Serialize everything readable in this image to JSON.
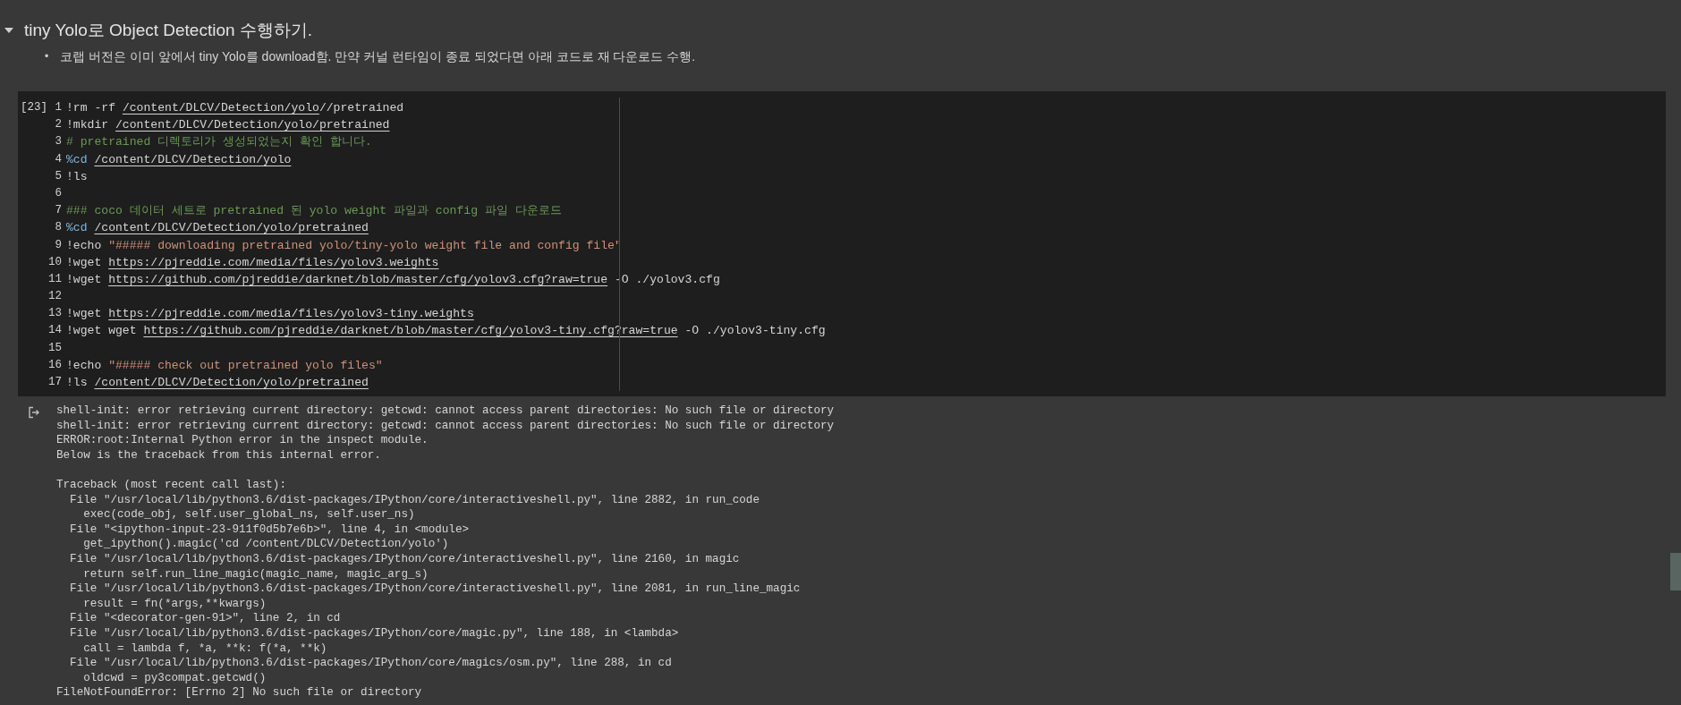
{
  "section": {
    "title": "tiny Yolo로 Object Detection 수행하기.",
    "expanded": true
  },
  "bullets": [
    {
      "marker": "•",
      "text": "코랩 버전은 이미 앞에서 tiny Yolo를 download함. 만약 커널 런타임이 종료 되었다면 아래 코드로 재 다운로드 수행."
    }
  ],
  "code_cell": {
    "execution_count": "[23]",
    "lines": [
      {
        "number": "1",
        "segments": [
          {
            "kind": "plain",
            "text": "!rm -rf "
          },
          {
            "kind": "link",
            "text": "/content/DLCV/Detection/yolo"
          },
          {
            "kind": "plain",
            "text": "//pretrained"
          }
        ]
      },
      {
        "number": "2",
        "segments": [
          {
            "kind": "plain",
            "text": "!mkdir "
          },
          {
            "kind": "link",
            "text": "/content/DLCV/Detection/yolo/pretrained"
          }
        ]
      },
      {
        "number": "3",
        "segments": [
          {
            "kind": "comment",
            "text": "# pretrained 디렉토리가 생성되었는지 확인 합니다."
          }
        ]
      },
      {
        "number": "4",
        "segments": [
          {
            "kind": "magic",
            "text": "%cd "
          },
          {
            "kind": "link",
            "text": "/content/DLCV/Detection/yolo"
          }
        ]
      },
      {
        "number": "5",
        "segments": [
          {
            "kind": "plain",
            "text": "!ls"
          }
        ]
      },
      {
        "number": "6"
      },
      {
        "number": "7",
        "segments": [
          {
            "kind": "comment",
            "text": "### coco 데이터 세트로 pretrained 된 yolo weight 파일과 config 파일 다운로드"
          }
        ]
      },
      {
        "number": "8",
        "segments": [
          {
            "kind": "magic",
            "text": "%cd "
          },
          {
            "kind": "link",
            "text": "/content/DLCV/Detection/yolo/pretrained"
          }
        ]
      },
      {
        "number": "9",
        "segments": [
          {
            "kind": "plain",
            "text": "!echo "
          },
          {
            "kind": "string",
            "text": "\"##### downloading pretrained yolo/tiny-yolo weight file and config file\""
          }
        ]
      },
      {
        "number": "10",
        "segments": [
          {
            "kind": "plain",
            "text": "!wget "
          },
          {
            "kind": "link",
            "text": "https://pjreddie.com/media/files/yolov3.weights"
          }
        ]
      },
      {
        "number": "11",
        "segments": [
          {
            "kind": "plain",
            "text": "!wget "
          },
          {
            "kind": "link",
            "text": "https://github.com/pjreddie/darknet/blob/master/cfg/yolov3.cfg?raw=true"
          },
          {
            "kind": "plain",
            "text": " -O ./yolov3.cfg"
          }
        ]
      },
      {
        "number": "12"
      },
      {
        "number": "13",
        "segments": [
          {
            "kind": "plain",
            "text": "!wget "
          },
          {
            "kind": "link",
            "text": "https://pjreddie.com/media/files/yolov3-tiny.weights"
          }
        ]
      },
      {
        "number": "14",
        "segments": [
          {
            "kind": "plain",
            "text": "!wget wget "
          },
          {
            "kind": "link",
            "text": "https://github.com/pjreddie/darknet/blob/master/cfg/yolov3-tiny.cfg?raw=true"
          },
          {
            "kind": "plain",
            "text": " -O ./yolov3-tiny.cfg"
          }
        ]
      },
      {
        "number": "15"
      },
      {
        "number": "16",
        "segments": [
          {
            "kind": "plain",
            "text": "!echo "
          },
          {
            "kind": "string",
            "text": "\"##### check out pretrained yolo files\""
          }
        ]
      },
      {
        "number": "17",
        "segments": [
          {
            "kind": "plain",
            "text": "!ls "
          },
          {
            "kind": "link",
            "text": "/content/DLCV/Detection/yolo/pretrained"
          }
        ]
      }
    ]
  },
  "output": {
    "blocks": [
      {
        "lines": [
          "shell-init: error retrieving current directory: getcwd: cannot access parent directories: No such file or directory",
          "shell-init: error retrieving current directory: getcwd: cannot access parent directories: No such file or directory",
          "ERROR:root:Internal Python error in the inspect module.",
          "Below is the traceback from this internal error."
        ]
      },
      {
        "lines": [
          "Traceback (most recent call last):",
          "  File \"/usr/local/lib/python3.6/dist-packages/IPython/core/interactiveshell.py\", line 2882, in run_code",
          "    exec(code_obj, self.user_global_ns, self.user_ns)",
          "  File \"<ipython-input-23-911f0d5b7e6b>\", line 4, in <module>",
          "    get_ipython().magic('cd /content/DLCV/Detection/yolo')",
          "  File \"/usr/local/lib/python3.6/dist-packages/IPython/core/interactiveshell.py\", line 2160, in magic",
          "    return self.run_line_magic(magic_name, magic_arg_s)",
          "  File \"/usr/local/lib/python3.6/dist-packages/IPython/core/interactiveshell.py\", line 2081, in run_line_magic",
          "    result = fn(*args,**kwargs)",
          "  File \"<decorator-gen-91>\", line 2, in cd",
          "  File \"/usr/local/lib/python3.6/dist-packages/IPython/core/magic.py\", line 188, in <lambda>",
          "    call = lambda f, *a, **k: f(*a, **k)",
          "  File \"/usr/local/lib/python3.6/dist-packages/IPython/core/magics/osm.py\", line 288, in cd",
          "    oldcwd = py3compat.getcwd()",
          "FileNotFoundError: [Errno 2] No such file or directory"
        ]
      }
    ]
  }
}
